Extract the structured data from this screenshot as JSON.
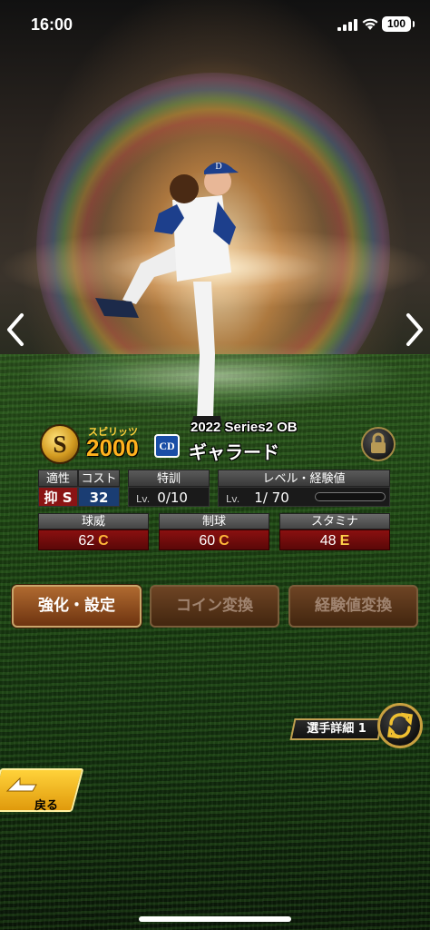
{
  "status_bar": {
    "time": "16:00",
    "battery": "100"
  },
  "card": {
    "spirit_label": "スピリッツ",
    "spirit_value": "2000",
    "spirit_rank": "S",
    "series": "2022 Series2 OB",
    "player_name": "ギャラード",
    "team_logo": "CD"
  },
  "stats": {
    "aptitude_label": "適性",
    "aptitude_value": "抑 S",
    "cost_label": "コスト",
    "cost_value": "32",
    "training_label": "特訓",
    "training_lv": "Lv.",
    "training_value": "0/10",
    "level_label": "レベル・経験値",
    "level_lv": "Lv.",
    "level_value": "1/ 70",
    "exp_progress": 0
  },
  "abilities": [
    {
      "label": "球威",
      "value": "62",
      "grade": "C"
    },
    {
      "label": "制球",
      "value": "60",
      "grade": "C"
    },
    {
      "label": "スタミナ",
      "value": "48",
      "grade": "E"
    }
  ],
  "actions": {
    "enhance": "強化・設定",
    "coin_exchange": "コイン変換",
    "exp_exchange": "経験値変換"
  },
  "detail": {
    "label": "選手詳細 1"
  },
  "back": {
    "label": "戻る"
  }
}
